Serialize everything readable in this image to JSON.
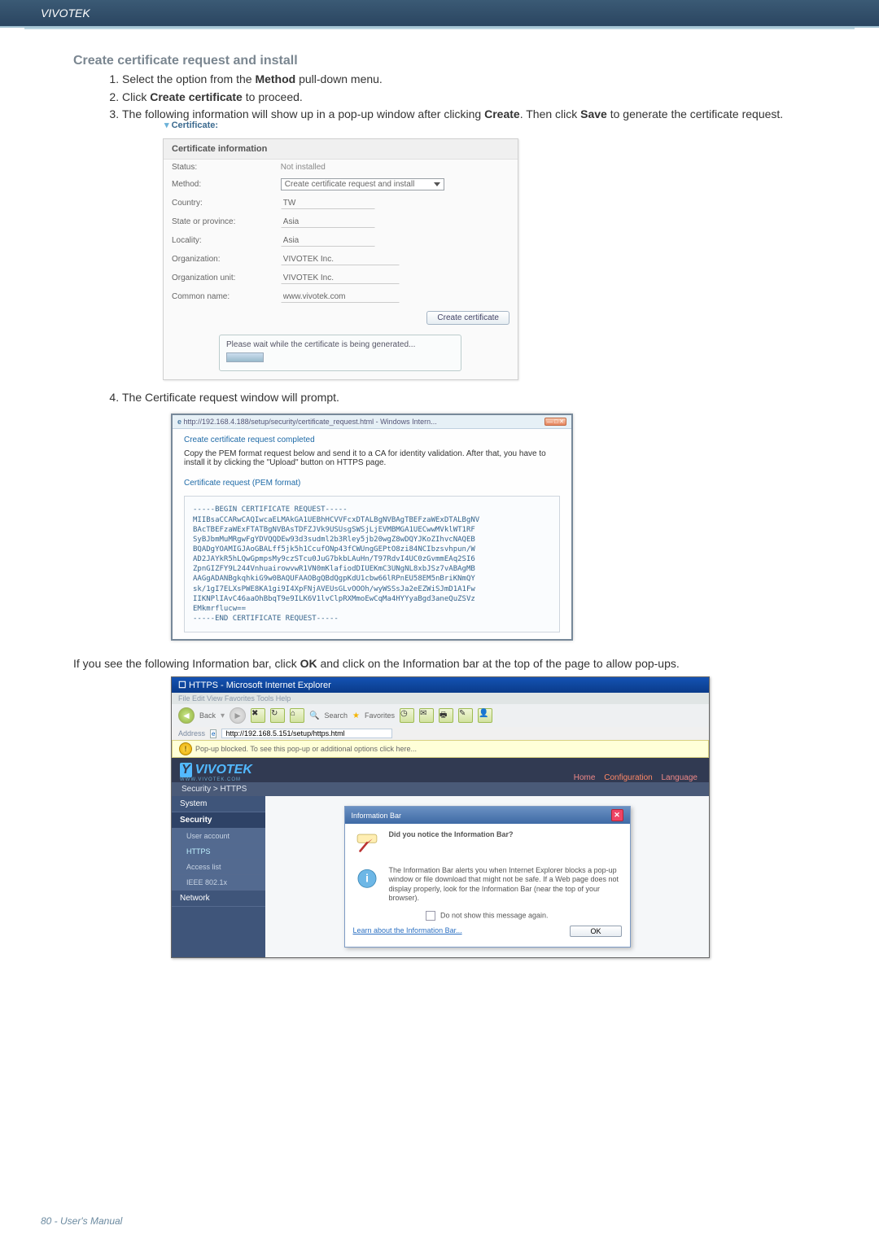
{
  "page": {
    "brand": "VIVOTEK",
    "footer": "80 - User's Manual"
  },
  "section": {
    "title": "Create certificate request and install",
    "steps": [
      "Select the option from the Method pull-down menu.",
      "Click Create certificate to proceed.",
      "The following information will show up in a pop-up window after clicking Create. Then click Save to generate the certificate request.",
      "The Certificate request window will prompt."
    ],
    "step1_bold": "Method",
    "step2_bold": "Create certificate",
    "step3_bold1": "Create",
    "step3_bold2": "Save"
  },
  "cert": {
    "top_label": "Certificate:",
    "legend": "Certificate information",
    "rows": {
      "status_l": "Status:",
      "status_v": "Not installed",
      "method_l": "Method:",
      "method_v": "Create certificate request and install",
      "country_l": "Country:",
      "country_v": "TW",
      "state_l": "State or province:",
      "state_v": "Asia",
      "locality_l": "Locality:",
      "locality_v": "Asia",
      "org_l": "Organization:",
      "org_v": "VIVOTEK Inc.",
      "orgunit_l": "Organization unit:",
      "orgunit_v": "VIVOTEK Inc.",
      "cn_l": "Common name:",
      "cn_v": "www.vivotek.com"
    },
    "button": "Create certificate",
    "gen_msg": "Please wait while the certificate is being generated..."
  },
  "prompt": {
    "url": "http://192.168.4.188/setup/security/certificate_request.html - Windows Intern...",
    "title": "Create certificate request completed",
    "desc": "Copy the PEM format request below and send it to a CA for identity validation. After that, you have to install it by clicking the \"Upload\" button on HTTPS page.",
    "pem_label": "Certificate request (PEM format)",
    "pem_lines": [
      "-----BEGIN CERTIFICATE REQUEST-----",
      "MIIBsaCCARwCAQIwcaELMAkGA1UEBhHCVVFcxDTALBgNVBAgTBEFzaWExDTALBgNV",
      "BAcTBEFzaWExFTATBgNVBAsTDFZJVk9USUsgSWSjLjEVMBMGA1UECwwMVklWT1RF",
      "SyBJbmMuMRgwFgYDVQQDEw93d3sudml2b3Rley5jb20wgZ8wDQYJKoZIhvcNAQEB",
      "BQADgYOAMIGJAoGBALff5jk5h1CcufONp43fCWUngGEPtO8zi84NCIbzsvhpun/W",
      "AD2JAYkR5hLQwGpmpsMy9czSTcu0JuG7bkbLAuHn/T97RdvI4UC0zGvmmEAq2SI6",
      "ZpnGIZFY9L244VnhuairowvwR1VN0mKlafiodDIUEKmC3UNgNL8xbJSz7vABAgMB",
      "AAGgADANBgkqhkiG9w0BAQUFAAOBgQBdQgpKdU1cbw66lRPnEU58EM5nBriKNmQY",
      "sk/1gI7ELXsPWE8KA1gi9I4XpFNjAVEUsGLvOOOh/wyWSSsJa2eEZWiSJmD1A1Fw",
      "IIKNPlIAvC46aaOhBbqT9e9ILK6V1lvClpRXMmoEwCqMa4HYYyaBgd3aneQuZSVz",
      "EMkmrflucw==",
      "-----END CERTIFICATE REQUEST-----"
    ]
  },
  "info_para": {
    "t1": "If you see the following Information bar, click ",
    "bold_ok": "OK",
    "t2": " and click on the Information bar at the top of the page to allow pop-ups."
  },
  "ie": {
    "title": "HTTPS - Microsoft Internet Explorer",
    "menu": "File   Edit   View   Favorites   Tools   Help",
    "toolbar": {
      "back": "Back",
      "search": "Search",
      "fav": "Favorites"
    },
    "address_label": "Address",
    "address": "http://192.168.5.151/setup/https.html",
    "infobar": "Pop-up blocked. To see this pop-up or additional options click here..."
  },
  "viv": {
    "logo": "VIVOTEK",
    "logo_sub": "WWW.VIVOTEK.COM",
    "links": {
      "home": "Home",
      "config": "Configuration",
      "lang": "Language"
    },
    "breadcrumb": "Security > HTTPS",
    "side": {
      "system": "System",
      "security": "Security",
      "user": "User account",
      "https": "HTTPS",
      "access": "Access list",
      "ieee": "IEEE 802.1x",
      "network": "Network"
    }
  },
  "info_dlg": {
    "title": "Information Bar",
    "q": "Did you notice the Information Bar?",
    "body": "The Information Bar alerts you when Internet Explorer blocks a pop-up window or file download that might not be safe. If a Web page does not display properly, look for the Information Bar (near the top of your browser).",
    "dont": "Do not show this message again.",
    "learn": "Learn about the Information Bar...",
    "ok": "OK"
  }
}
